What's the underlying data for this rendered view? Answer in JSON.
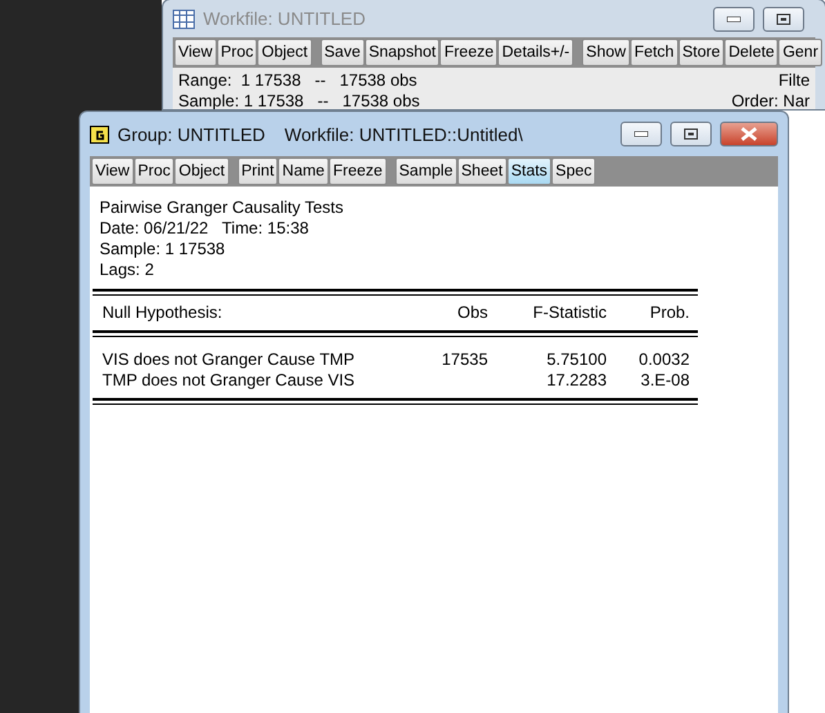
{
  "workfile_window": {
    "title": "Workfile: UNTITLED",
    "toolbar_groups": [
      [
        "View",
        "Proc",
        "Object"
      ],
      [
        "Save",
        "Snapshot",
        "Freeze",
        "Details+/-"
      ],
      [
        "Show",
        "Fetch",
        "Store",
        "Delete",
        "Genr"
      ]
    ],
    "range": {
      "label": "Range:",
      "value": "1 17538   --   17538 obs"
    },
    "sample": {
      "label": "Sample:",
      "value": "1 17538   --   17538 obs"
    },
    "filter": "Filte",
    "order": "Order: Nar"
  },
  "group_window": {
    "title": "Group: UNTITLED",
    "workfile": "Workfile: UNTITLED::Untitled\\",
    "toolbar_groups": [
      [
        {
          "label": "View",
          "selected": false
        },
        {
          "label": "Proc",
          "selected": false
        },
        {
          "label": "Object",
          "selected": false
        }
      ],
      [
        {
          "label": "Print",
          "selected": false
        },
        {
          "label": "Name",
          "selected": false
        },
        {
          "label": "Freeze",
          "selected": false
        }
      ],
      [
        {
          "label": "Sample",
          "selected": false
        },
        {
          "label": "Sheet",
          "selected": false
        },
        {
          "label": "Stats",
          "selected": true
        },
        {
          "label": "Spec",
          "selected": false
        }
      ]
    ],
    "header_lines": [
      "Pairwise Granger Causality Tests",
      "Date: 06/21/22   Time: 15:38",
      "Sample: 1 17538",
      "Lags: 2"
    ],
    "table": {
      "columns": [
        "Null Hypothesis:",
        "Obs",
        "F-Statistic",
        "Prob."
      ],
      "rows": [
        [
          "VIS does not Granger Cause TMP",
          "17535",
          "5.75100",
          "0.0032"
        ],
        [
          "TMP does not Granger Cause VIS",
          "",
          "17.2283",
          "3.E-08"
        ]
      ]
    }
  }
}
